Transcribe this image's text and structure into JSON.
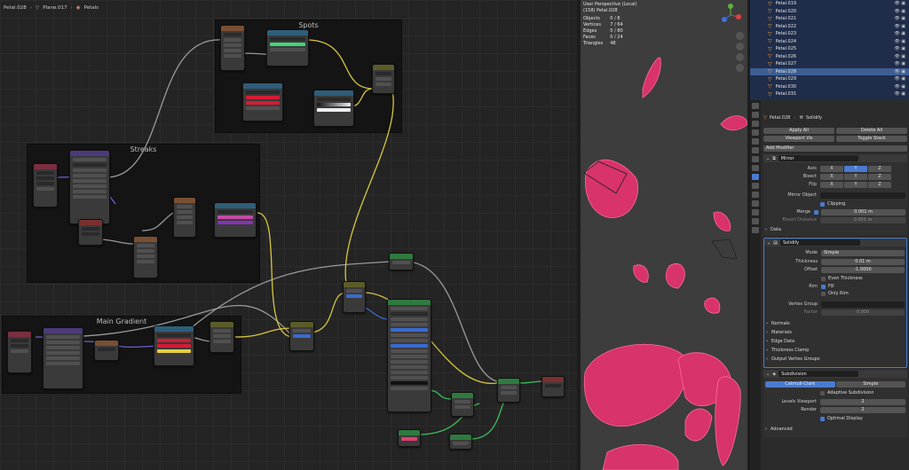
{
  "breadcrumb": {
    "object": "Petal.028",
    "mesh": "Plane.017",
    "material": "Petals"
  },
  "frames": {
    "spots": "Spots",
    "streaks": "Streaks",
    "main_gradient": "Main Gradient"
  },
  "viewport": {
    "view": "User Perspective (Local)",
    "collection": "(158) Petal.028",
    "stats": [
      [
        "Objects",
        "0 / 8"
      ],
      [
        "Vertices",
        "7 / 64"
      ],
      [
        "Edges",
        "0 / 80"
      ],
      [
        "Faces",
        "0 / 24"
      ],
      [
        "Triangles",
        "48"
      ]
    ]
  },
  "outliner": {
    "items": [
      "Petal.019",
      "Petal.020",
      "Petal.021",
      "Petal.022",
      "Petal.023",
      "Petal.024",
      "Petal.025",
      "Petal.026",
      "Petal.027",
      "Petal.028",
      "Petal.029",
      "Petal.030",
      "Petal.031"
    ],
    "selected_index": 9
  },
  "properties": {
    "breadcrumb_object": "Petal.028",
    "breadcrumb_modifier": "Solidify",
    "apply_all": "Apply All",
    "delete_all": "Delete All",
    "viewport_vis": "Viewport Vis",
    "toggle_stack": "Toggle Stack",
    "add_modifier": "Add Modifier",
    "mirror": {
      "name": "Mirror",
      "axis": "Axis",
      "bisect": "Bisect",
      "flip": "Flip",
      "x": "X",
      "y": "Y",
      "z": "Z",
      "mirror_object": "Mirror Object",
      "clipping": "Clipping",
      "merge": "Merge",
      "merge_value": "0.001 m",
      "bisect_distance": "Bisect Distance",
      "bisect_distance_value": "0.001 m",
      "data": "Data"
    },
    "solidify": {
      "name": "Solidify",
      "mode": "Mode",
      "mode_value": "Simple",
      "thickness": "Thickness",
      "thickness_value": "0.01 m",
      "offset": "Offset",
      "offset_value": "-1.0000",
      "even_thickness": "Even Thickness",
      "rim": "Rim",
      "fill": "Fill",
      "only_rim": "Only Rim",
      "vertex_group": "Vertex Group",
      "factor": "Factor",
      "factor_value": "0.000",
      "normals": "Normals",
      "materials": "Materials",
      "edge_data": "Edge Data",
      "thickness_clamp": "Thickness Clamp",
      "output_vertex_groups": "Output Vertex Groups"
    },
    "subdivision": {
      "name": "Subdivision",
      "catmull": "Catmull-Clark",
      "simple": "Simple",
      "adaptive": "Adaptive Subdivision",
      "levels_viewport": "Levels Viewport",
      "levels_viewport_value": "2",
      "render": "Render",
      "render_value": "2",
      "optimal_display": "Optimal Display",
      "advanced": "Advanced"
    }
  },
  "colors": {
    "petal": "#e0406e",
    "petal_edge": "#ff6a9a",
    "accent": "#4a7bd0",
    "wire_yellow": "#d6c640",
    "wire_gray": "#9a9a9a",
    "wire_green": "#3fbf5a",
    "wire_purple": "#6a5fd0"
  }
}
